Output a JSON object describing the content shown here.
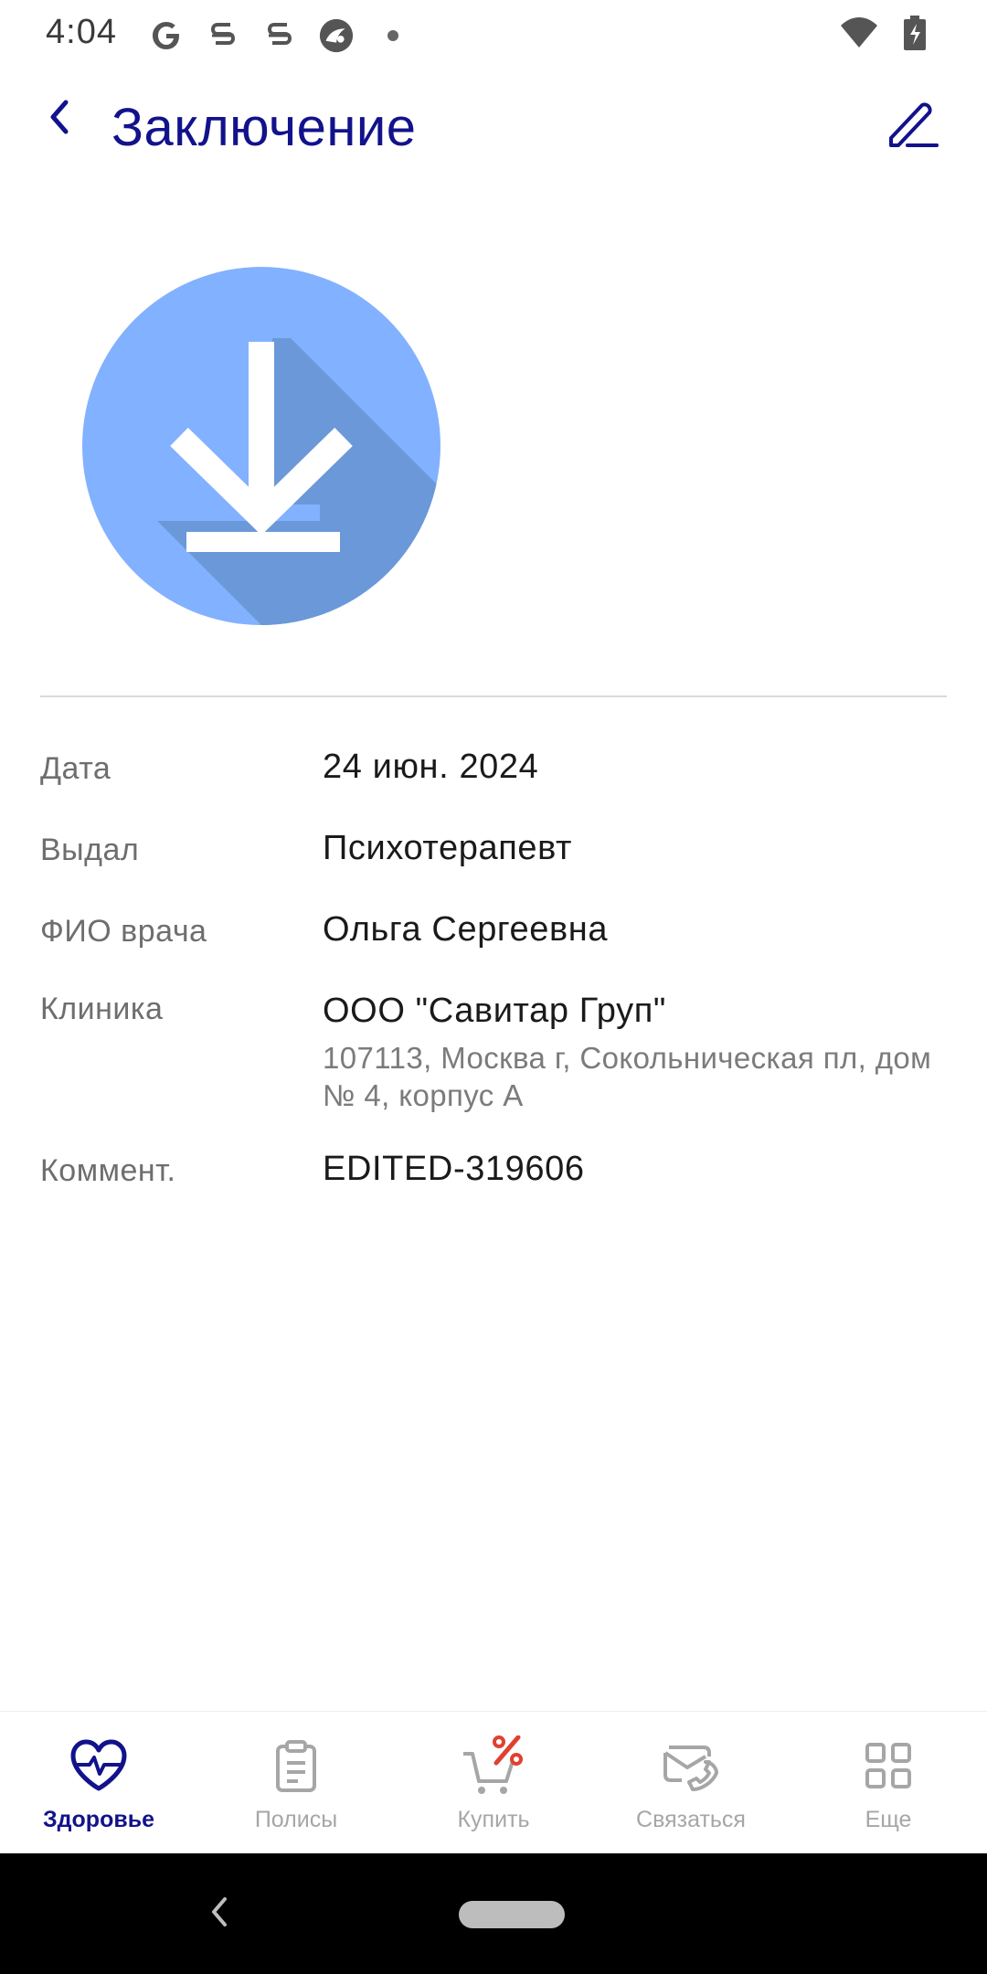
{
  "status_bar": {
    "time": "4:04",
    "left_icons": [
      "google-icon",
      "s-app-icon",
      "s-app-icon",
      "lens-app-icon",
      "notification-dot-icon"
    ],
    "right_icons": [
      "wifi-icon",
      "battery-charging-icon"
    ]
  },
  "header": {
    "title": "Заключение",
    "back_icon": "chevron-left-icon",
    "edit_icon": "pencil-icon"
  },
  "download": {
    "icon": "download-icon",
    "circle_color": "#82b1ff",
    "shadow_color": "#6b98d8"
  },
  "details": {
    "date": {
      "label": "Дата",
      "value": "24 июн. 2024"
    },
    "issuer": {
      "label": "Выдал",
      "value": "Психотерапевт"
    },
    "doctor": {
      "label": "ФИО врача",
      "value": "Ольга Сергеевна"
    },
    "clinic": {
      "label": "Клиника",
      "value": "ООО \"Савитар Груп\"",
      "address": "107113, Москва г, Сокольническая пл, дом № 4, корпус А"
    },
    "comment": {
      "label": "Коммент.",
      "value": "EDITED-319606"
    }
  },
  "bottom_nav": {
    "items": [
      {
        "label": "Здоровье",
        "icon": "heart-pulse-icon",
        "active": true
      },
      {
        "label": "Полисы",
        "icon": "clipboard-icon",
        "active": false
      },
      {
        "label": "Купить",
        "icon": "cart-percent-icon",
        "active": false
      },
      {
        "label": "Связаться",
        "icon": "phone-mail-icon",
        "active": false
      },
      {
        "label": "Еще",
        "icon": "grid-icon",
        "active": false
      }
    ]
  },
  "colors": {
    "accent": "#12128c",
    "inactive": "#a6a6a6",
    "sale_red": "#e0412f"
  }
}
